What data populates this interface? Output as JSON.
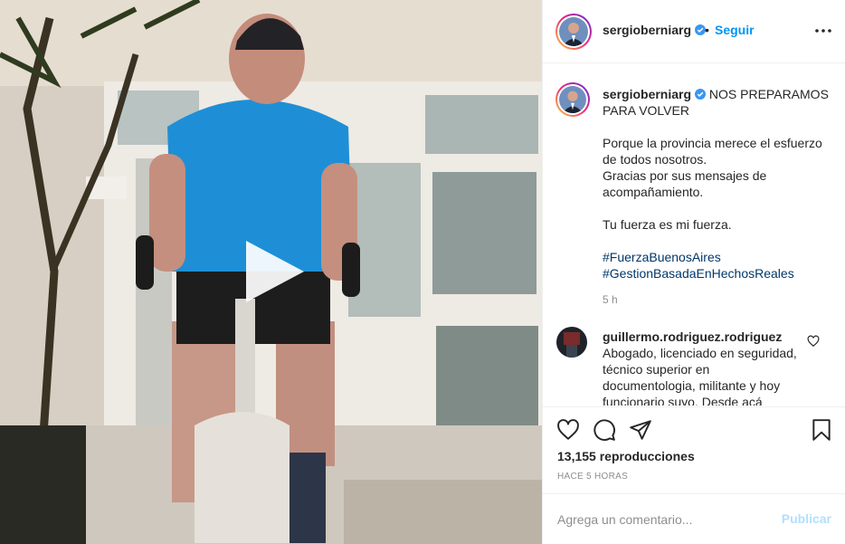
{
  "post": {
    "username": "sergioberniarg",
    "separator": "•",
    "follow_label": "Seguir",
    "more_icon": "more-horizontal-icon",
    "verified_icon": "verified-badge-icon"
  },
  "caption": {
    "username": "sergioberniarg",
    "lines": [
      "NOS PREPARAMOS PARA VOLVER",
      "",
      "Porque la provincia merece el esfuerzo de todos nosotros.",
      "Gracias por sus mensajes de acompañamiento.",
      "",
      "Tu fuerza es mi fuerza.",
      ""
    ],
    "hashtags": [
      "#FuerzaBuenosAires",
      "#GestionBasadaEnHechosReales"
    ],
    "time": "5 h"
  },
  "comment": {
    "username": "guillermo.rodriguez.rodriguez",
    "text": "Abogado, licenciado en seguridad, técnico superior en documentologia, militante y hoy funcionario suyo. Desde acá"
  },
  "actions": {
    "icons": [
      "heart-icon",
      "comment-icon",
      "share-icon",
      "bookmark-icon"
    ],
    "views": "13,155 reproducciones",
    "time_ago": "HACE 5 HORAS"
  },
  "composer": {
    "placeholder": "Agrega un comentario...",
    "publish_label": "Publicar"
  },
  "colors": {
    "link_blue": "#0095f6",
    "hashtag": "#00376b",
    "muted": "#8e8e8e",
    "publish_disabled": "#b2dffc"
  }
}
